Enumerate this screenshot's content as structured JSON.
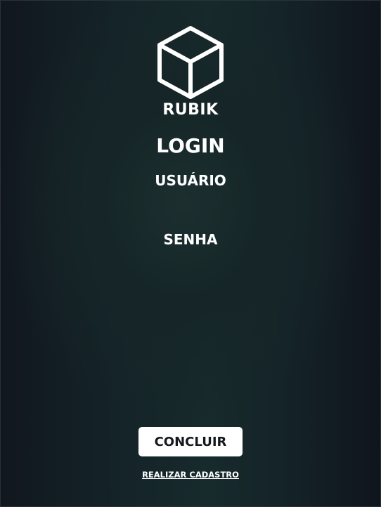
{
  "brand": {
    "logo_icon": "cube-icon",
    "name": "RUBIK"
  },
  "login": {
    "title": "LOGIN",
    "username_label": "USUÁRIO",
    "username_value": "",
    "password_label": "SENHA",
    "password_value": "",
    "submit_label": "CONCLUIR",
    "register_label": "REALIZAR CADASTRO"
  },
  "colors": {
    "background_dark": "#11171f",
    "background_teal": "#1c2f2f",
    "text": "#ffffff",
    "button_bg": "#ffffff",
    "button_text": "#15191d"
  }
}
